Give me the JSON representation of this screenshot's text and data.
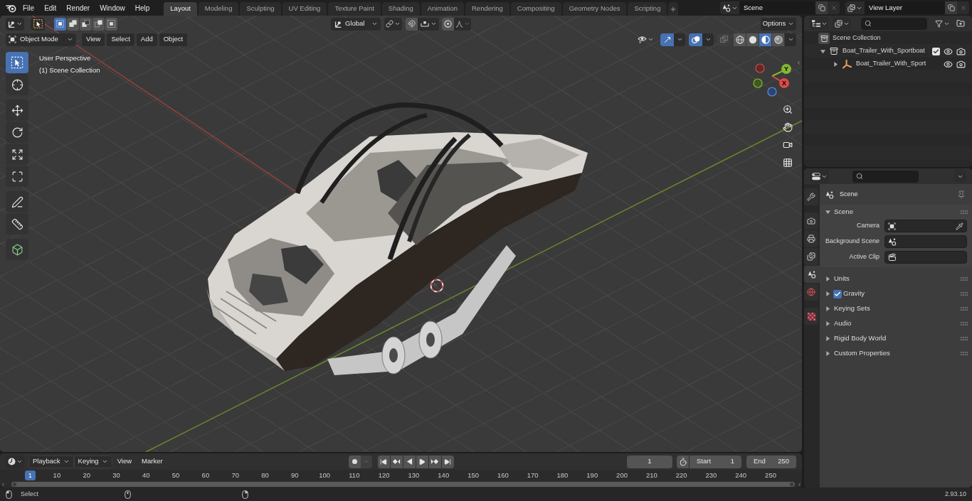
{
  "menus": [
    {
      "label": "File"
    },
    {
      "label": "Edit"
    },
    {
      "label": "Render"
    },
    {
      "label": "Window"
    },
    {
      "label": "Help"
    }
  ],
  "workspaces": [
    {
      "label": "Layout",
      "selected": true
    },
    {
      "label": "Modeling",
      "selected": false
    },
    {
      "label": "Sculpting",
      "selected": false
    },
    {
      "label": "UV Editing",
      "selected": false
    },
    {
      "label": "Texture Paint",
      "selected": false
    },
    {
      "label": "Shading",
      "selected": false
    },
    {
      "label": "Animation",
      "selected": false
    },
    {
      "label": "Rendering",
      "selected": false
    },
    {
      "label": "Compositing",
      "selected": false
    },
    {
      "label": "Geometry Nodes",
      "selected": false
    },
    {
      "label": "Scripting",
      "selected": false
    }
  ],
  "scene_selector": {
    "value": "Scene"
  },
  "view_layer_selector": {
    "value": "View Layer"
  },
  "viewport": {
    "transform_orientation": "Global",
    "options": "Options",
    "mode": "Object Mode",
    "menus": [
      "View",
      "Select",
      "Add",
      "Object"
    ],
    "select_modes": [
      {
        "kind": "set",
        "selected": true
      },
      {
        "kind": "extend",
        "selected": false
      },
      {
        "kind": "subtract",
        "selected": false
      },
      {
        "kind": "invert",
        "selected": false
      },
      {
        "kind": "intersect",
        "selected": false
      }
    ],
    "toggles": [
      {
        "kind": "gizmos",
        "on": true
      },
      {
        "kind": "overlays",
        "on": true
      },
      {
        "kind": "xray",
        "on": false
      }
    ],
    "shading": [
      {
        "kind": "wireframe",
        "selected": false
      },
      {
        "kind": "solid",
        "selected": false
      },
      {
        "kind": "material",
        "selected": true
      },
      {
        "kind": "rendered",
        "selected": false
      }
    ],
    "overlay_text": [
      "User Perspective",
      "(1) Scene Collection"
    ],
    "tool_groups": [
      [
        {
          "kind": "select_box",
          "selected": true
        },
        {
          "kind": "cursor",
          "selected": false
        }
      ],
      [
        {
          "kind": "move",
          "selected": false
        },
        {
          "kind": "rotate",
          "selected": false
        },
        {
          "kind": "scale",
          "selected": false
        },
        {
          "kind": "transform",
          "selected": false
        }
      ],
      [
        {
          "kind": "annotate",
          "selected": false
        },
        {
          "kind": "measure",
          "selected": false
        }
      ],
      [
        {
          "kind": "add_cube",
          "selected": false
        }
      ]
    ],
    "gizmo_labels": {
      "x": "X",
      "y": "Y"
    }
  },
  "outliner": {
    "items": [
      {
        "label": "Scene Collection",
        "kind": "scene_collection",
        "children": [
          {
            "label": "Boat_Trailer_With_Sportboat",
            "kind": "collection",
            "expanded": true,
            "checked": true,
            "children": [
              {
                "label": "Boat_Trailer_With_Sport",
                "kind": "empty",
                "expanded": false
              }
            ]
          }
        ]
      }
    ]
  },
  "properties": {
    "tab_groups": [
      [
        {
          "kind": "tool",
          "selected": false
        }
      ],
      [
        {
          "kind": "render",
          "selected": false
        },
        {
          "kind": "output",
          "selected": false
        },
        {
          "kind": "view_layer",
          "selected": false
        },
        {
          "kind": "scene",
          "selected": true
        },
        {
          "kind": "world",
          "selected": false
        }
      ],
      [
        {
          "kind": "texture",
          "selected": false
        }
      ]
    ],
    "context": "Scene",
    "panels": [
      {
        "title": "Scene",
        "kind": "plain",
        "expanded": true,
        "fields": [
          {
            "label": "Camera",
            "kind": "camera"
          },
          {
            "label": "Background Scene",
            "kind": "scene"
          },
          {
            "label": "Active Clip",
            "kind": "clip"
          }
        ]
      },
      {
        "title": "Units",
        "kind": "plain",
        "expanded": false
      },
      {
        "title": "Gravity",
        "kind": "toggle",
        "expanded": false,
        "checked": true
      },
      {
        "title": "Keying Sets",
        "kind": "plain",
        "expanded": false
      },
      {
        "title": "Audio",
        "kind": "plain",
        "expanded": false
      },
      {
        "title": "Rigid Body World",
        "kind": "plain",
        "expanded": false
      },
      {
        "title": "Custom Properties",
        "kind": "plain",
        "expanded": false
      }
    ]
  },
  "timeline": {
    "menus": [
      {
        "label": "Playback",
        "kind": "dropdown"
      },
      {
        "label": "Keying",
        "kind": "dropdown"
      },
      {
        "label": "View",
        "kind": "menu"
      },
      {
        "label": "Marker",
        "kind": "menu"
      }
    ],
    "current_frame": "1",
    "start": {
      "label": "Start",
      "value": "1"
    },
    "end": {
      "label": "End",
      "value": "250"
    },
    "ruler": [
      {
        "label": "1",
        "current": true
      },
      {
        "label": "10",
        "current": false
      },
      {
        "label": "20",
        "current": false
      },
      {
        "label": "30",
        "current": false
      },
      {
        "label": "40",
        "current": false
      },
      {
        "label": "50",
        "current": false
      },
      {
        "label": "60",
        "current": false
      },
      {
        "label": "70",
        "current": false
      },
      {
        "label": "80",
        "current": false
      },
      {
        "label": "90",
        "current": false
      },
      {
        "label": "100",
        "current": false
      },
      {
        "label": "110",
        "current": false
      },
      {
        "label": "120",
        "current": false
      },
      {
        "label": "130",
        "current": false
      },
      {
        "label": "140",
        "current": false
      },
      {
        "label": "150",
        "current": false
      },
      {
        "label": "160",
        "current": false
      },
      {
        "label": "170",
        "current": false
      },
      {
        "label": "180",
        "current": false
      },
      {
        "label": "190",
        "current": false
      },
      {
        "label": "200",
        "current": false
      },
      {
        "label": "210",
        "current": false
      },
      {
        "label": "220",
        "current": false
      },
      {
        "label": "230",
        "current": false
      },
      {
        "label": "240",
        "current": false
      },
      {
        "label": "250",
        "current": false
      }
    ]
  },
  "status_bar": {
    "hint": "Select",
    "version": "2.93.10"
  }
}
